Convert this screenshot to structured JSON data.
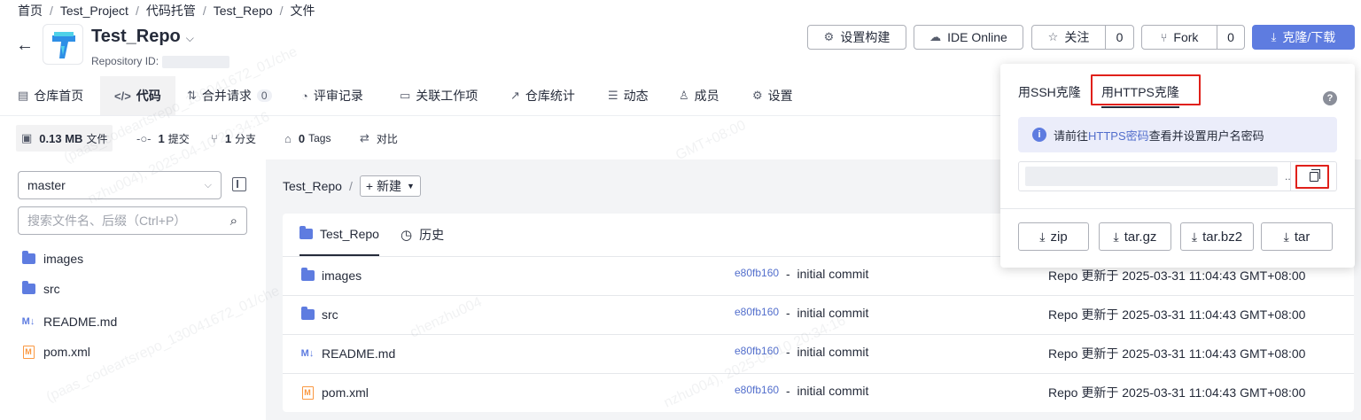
{
  "breadcrumb": [
    "首页",
    "Test_Project",
    "代码托管",
    "Test_Repo",
    "文件"
  ],
  "repo": {
    "name": "Test_Repo",
    "id_label": "Repository ID:"
  },
  "actions": {
    "settings_build": "设置构建",
    "ide_online": "IDE Online",
    "watch": "关注",
    "watch_count": "0",
    "fork": "Fork",
    "fork_count": "0",
    "clone": "克隆/下载"
  },
  "nav": [
    {
      "label": "仓库首页",
      "icon": "doc-icon"
    },
    {
      "label": "代码",
      "icon": "code-icon"
    },
    {
      "label": "合并请求",
      "icon": "merge-icon",
      "count": "0"
    },
    {
      "label": "评审记录",
      "icon": "review-icon"
    },
    {
      "label": "关联工作项",
      "icon": "workitem-icon"
    },
    {
      "label": "仓库统计",
      "icon": "stats-icon"
    },
    {
      "label": "动态",
      "icon": "list-icon"
    },
    {
      "label": "成员",
      "icon": "user-icon"
    },
    {
      "label": "设置",
      "icon": "gear-icon"
    }
  ],
  "stats": {
    "size_value": "0.13 MB",
    "size_label": "文件",
    "commits_value": "1",
    "commits_label": "提交",
    "branches_value": "1",
    "branches_label": "分支",
    "tags_value": "0",
    "tags_label": "Tags",
    "compare_label": "对比"
  },
  "sidebar": {
    "branch": "master",
    "search_placeholder": "搜索文件名、后缀（Ctrl+P）",
    "tree": [
      {
        "name": "images",
        "type": "folder"
      },
      {
        "name": "src",
        "type": "folder"
      },
      {
        "name": "README.md",
        "type": "md"
      },
      {
        "name": "pom.xml",
        "type": "xml"
      }
    ]
  },
  "main": {
    "crumb_repo": "Test_Repo",
    "new_label": "新建",
    "tab_files": "Test_Repo",
    "tab_history": "历史",
    "rows": [
      {
        "name": "images",
        "type": "folder",
        "hash": "e80fb160",
        "message": "initial commit",
        "time": "Repo 更新于 2025-03-31 11:04:43 GMT+08:00"
      },
      {
        "name": "src",
        "type": "folder",
        "hash": "e80fb160",
        "message": "initial commit",
        "time": "Repo 更新于 2025-03-31 11:04:43 GMT+08:00"
      },
      {
        "name": "README.md",
        "type": "md",
        "hash": "e80fb160",
        "message": "initial commit",
        "time": "Repo 更新于 2025-03-31 11:04:43 GMT+08:00"
      },
      {
        "name": "pom.xml",
        "type": "xml",
        "hash": "e80fb160",
        "message": "initial commit",
        "time": "Repo 更新于 2025-03-31 11:04:43 GMT+08:00"
      }
    ]
  },
  "clone_popup": {
    "tab_ssh": "用SSH克隆",
    "tab_https": "用HTTPS克隆",
    "notice_prefix": "请前往",
    "notice_link": "HTTPS密码",
    "notice_suffix": "查看并设置用户名密码",
    "url_ellipsis": "..",
    "downloads": [
      "zip",
      "tar.gz",
      "tar.bz2",
      "tar"
    ]
  },
  "watermark": [
    "chenzhu004",
    "(paas_codeartsrepo_130041672_01/che",
    "nzhu004), 2025-04-10 20:34:16",
    "GMT+08:00"
  ],
  "colors": {
    "accent": "#5e7ce0",
    "highlight": "#e0201a"
  }
}
